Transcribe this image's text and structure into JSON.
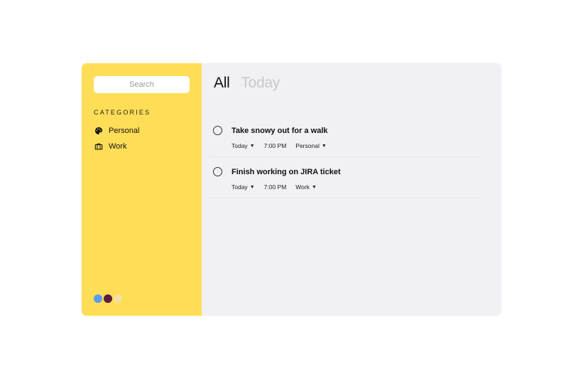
{
  "search": {
    "placeholder": "Search"
  },
  "categories": {
    "heading": "CATEGORIES",
    "items": [
      {
        "label": "Personal",
        "icon": "palette-icon"
      },
      {
        "label": "Work",
        "icon": "briefcase-icon"
      }
    ]
  },
  "theme_swatches": [
    {
      "color": "#5B9CF2"
    },
    {
      "color": "#5A1E3F"
    },
    {
      "color": "#F5E0A0"
    }
  ],
  "colors": {
    "sidebar": "#FEDD57",
    "main": "#F0F0F5",
    "active_tab": "#111111",
    "inactive_tab": "#C9C9CC"
  },
  "tabs": [
    {
      "label": "All",
      "active": true
    },
    {
      "label": "Today",
      "active": false
    }
  ],
  "tasks": [
    {
      "title": "Take snowy out for a walk",
      "due": "Today",
      "time": "7:00 PM",
      "category": "Personal",
      "completed": false
    },
    {
      "title": "Finish working on JIRA ticket",
      "due": "Today",
      "time": "7:00 PM",
      "category": "Work",
      "completed": false
    }
  ]
}
